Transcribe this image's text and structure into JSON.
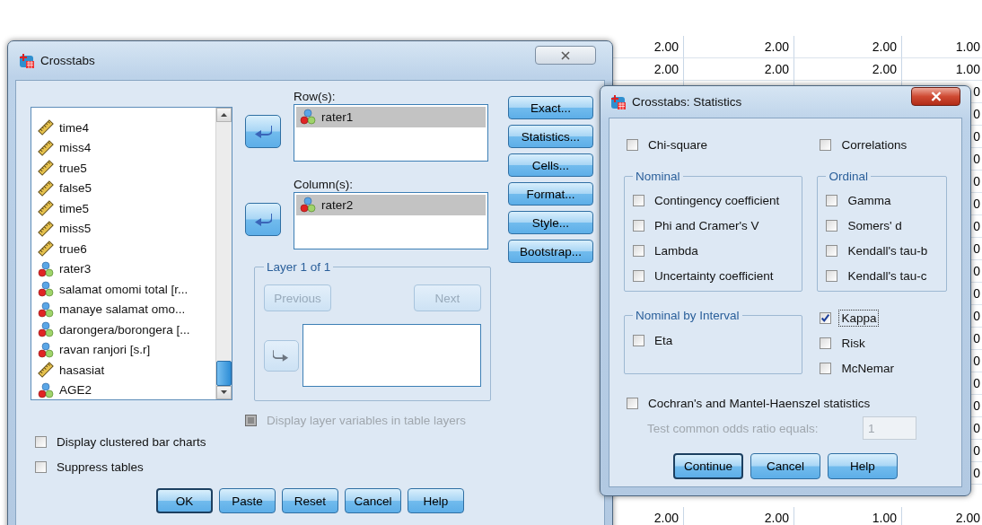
{
  "data_grid": {
    "rows": [
      {
        "column_1": "2.00",
        "column_2": "2.00",
        "column_3": "2.00",
        "column_4": "1.00"
      },
      {
        "column_1": "2.00",
        "column_2": "2.00",
        "column_3": "2.00",
        "column_4": "1.00"
      },
      {
        "column_4": "0"
      },
      {
        "column_4": "0"
      },
      {
        "column_4": "0"
      },
      {
        "column_4": "0"
      },
      {
        "column_4": "0"
      },
      {
        "column_4": "0"
      },
      {
        "column_4": "0"
      },
      {
        "column_4": "0"
      },
      {
        "column_4": "0"
      },
      {
        "column_4": "0"
      },
      {
        "column_4": "0"
      },
      {
        "column_4": "0"
      },
      {
        "column_4": "0"
      },
      {
        "column_4": "0"
      },
      {
        "column_4": "0"
      },
      {
        "column_4": "0"
      },
      {
        "column_4": "0"
      },
      {
        "column_4": "0"
      },
      {
        "column_1": "2.00",
        "column_2": "2.00",
        "column_3": "1.00",
        "column_4": "2.00"
      }
    ]
  },
  "crosstabs": {
    "title": "Crosstabs",
    "variables": [
      {
        "name": "time4",
        "kind": "scale",
        "selected": false
      },
      {
        "name": "miss4",
        "kind": "scale",
        "selected": false
      },
      {
        "name": "true5",
        "kind": "scale",
        "selected": false
      },
      {
        "name": "false5",
        "kind": "scale",
        "selected": false
      },
      {
        "name": "time5",
        "kind": "scale",
        "selected": false
      },
      {
        "name": "miss5",
        "kind": "scale",
        "selected": false
      },
      {
        "name": "true6",
        "kind": "scale",
        "selected": false
      },
      {
        "name": "rater3",
        "kind": "nominal",
        "selected": false
      },
      {
        "name": "salamat omomi total [r...",
        "kind": "nominal",
        "selected": false
      },
      {
        "name": "manaye salamat omo...",
        "kind": "nominal",
        "selected": false
      },
      {
        "name": "darongera/borongera [...",
        "kind": "nominal",
        "selected": false
      },
      {
        "name": "ravan ranjori [s.r]",
        "kind": "nominal",
        "selected": false
      },
      {
        "name": "hasasiat",
        "kind": "scale",
        "selected": false
      },
      {
        "name": "AGE2",
        "kind": "nominal",
        "selected": false
      }
    ],
    "rows_label": {
      "text": "Row(s):"
    },
    "rows": [
      {
        "name": "rater1",
        "kind": "nominal",
        "selected": true
      }
    ],
    "columns_label": {
      "text": "Column(s):"
    },
    "columns": [
      {
        "name": "rater2",
        "kind": "nominal",
        "selected": true
      }
    ],
    "layer": {
      "title": "Layer 1 of 1",
      "arrow_disabled": true,
      "previous": {
        "label": "Previous",
        "disabled": true
      },
      "next": {
        "label": "Next",
        "disabled": true
      }
    },
    "display_layer": {
      "label": "Display layer variables in table layers",
      "checked": false,
      "disabled": true
    },
    "options": [
      {
        "label": "Display clustered bar charts",
        "checked": false
      },
      {
        "label": "Suppress tables",
        "checked": false
      }
    ],
    "side_buttons": [
      {
        "label": "Exact..."
      },
      {
        "label": "Statistics..."
      },
      {
        "label": "Cells..."
      },
      {
        "label": "Format..."
      },
      {
        "label": "Style..."
      },
      {
        "label": "Bootstrap..."
      }
    ],
    "buttons": [
      {
        "label": "OK",
        "default": true
      },
      {
        "label": "Paste",
        "default": false
      },
      {
        "label": "Reset",
        "default": false
      },
      {
        "label": "Cancel",
        "default": false
      },
      {
        "label": "Help",
        "default": false
      }
    ]
  },
  "statistics": {
    "title": "Crosstabs: Statistics",
    "chi_square": {
      "label": "Chi-square",
      "checked": false
    },
    "correlations": {
      "label": "Correlations",
      "checked": false
    },
    "nominal": {
      "title": "Nominal",
      "items": [
        {
          "label": "Contingency coefficient",
          "checked": false
        },
        {
          "label": "Phi and Cramer's V",
          "checked": false
        },
        {
          "label": "Lambda",
          "checked": false
        },
        {
          "label": "Uncertainty coefficient",
          "checked": false
        }
      ]
    },
    "ordinal": {
      "title": "Ordinal",
      "items": [
        {
          "label": "Gamma",
          "checked": false
        },
        {
          "label": "Somers' d",
          "checked": false
        },
        {
          "label": "Kendall's tau-b",
          "checked": false
        },
        {
          "label": "Kendall's tau-c",
          "checked": false
        }
      ]
    },
    "nominal_by_interval": {
      "title": "Nominal by Interval",
      "items": [
        {
          "label": "Eta",
          "checked": false
        }
      ]
    },
    "other": [
      {
        "label": "Kappa",
        "checked": true,
        "focused": true
      },
      {
        "label": "Risk",
        "checked": false,
        "focused": false
      },
      {
        "label": "McNemar",
        "checked": false,
        "focused": false
      }
    ],
    "cochran": {
      "label": "Cochran's and Mantel-Haenszel statistics",
      "checked": false
    },
    "odds_ratio": {
      "label": "Test common odds ratio equals:",
      "value": "1",
      "disabled": true
    },
    "buttons": [
      {
        "label": "Continue",
        "default": true
      },
      {
        "label": "Cancel",
        "default": false
      },
      {
        "label": "Help",
        "default": false
      }
    ]
  }
}
